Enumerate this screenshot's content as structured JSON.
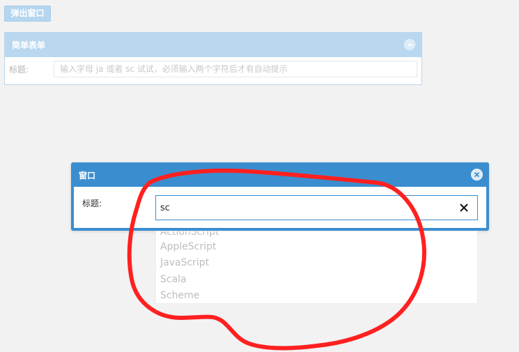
{
  "popup_button": {
    "label": "弹出窗口"
  },
  "simple_form": {
    "title": "简单表单",
    "field_label": "标题:",
    "input_placeholder": "输入字母 ja 或者 sc 试试，必须输入两个字符后才有自动提示",
    "input_value": ""
  },
  "window": {
    "title": "窗口",
    "field_label": "标题:",
    "input_value": "sc"
  },
  "suggestions": [
    "ActionScript",
    "AppleScript",
    "JavaScript",
    "Scala",
    "Scheme"
  ],
  "colors": {
    "window_header": "#3a8ed0",
    "panel_header": "#b9d8ef",
    "annotation_stroke": "#ff2020"
  },
  "icons": {
    "collapse": "chevron-up-icon",
    "close": "close-icon",
    "clear": "clear-icon"
  }
}
